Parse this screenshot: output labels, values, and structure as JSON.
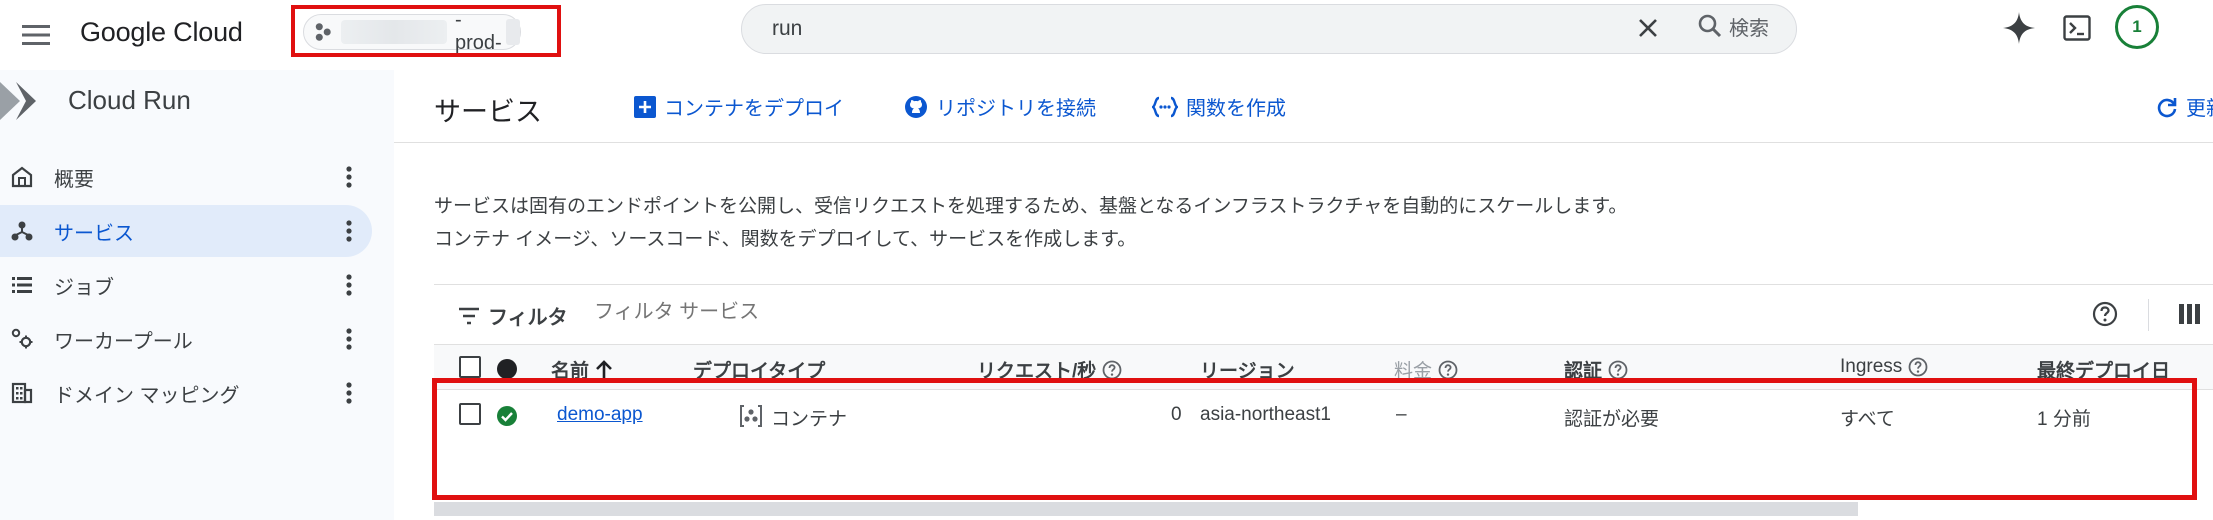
{
  "header": {
    "brand": "Google Cloud",
    "project_name": "-prod-",
    "search_value": "run",
    "search_button": "検索",
    "notification_count": "1"
  },
  "sidebar": {
    "product_title": "Cloud Run",
    "items": [
      {
        "label": "概要",
        "icon": "home-icon"
      },
      {
        "label": "サービス",
        "icon": "services-icon",
        "active": true
      },
      {
        "label": "ジョブ",
        "icon": "list-icon"
      },
      {
        "label": "ワーカープール",
        "icon": "workerpool-icon"
      },
      {
        "label": "ドメイン マッピング",
        "icon": "building-icon"
      }
    ]
  },
  "main": {
    "title": "サービス",
    "actions": {
      "deploy_container": "コンテナをデプロイ",
      "connect_repo": "リポジトリを接続",
      "create_function": "関数を作成",
      "refresh": "更新"
    },
    "description_line1": "サービスは固有のエンドポイントを公開し、受信リクエストを処理するため、基盤となるインフラストラクチャを自動的にスケールします。",
    "description_line2": "コンテナ イメージ、ソースコード、関数をデプロイして、サービスを作成します。",
    "filter": {
      "label": "フィルタ",
      "placeholder": "フィルタ サービス"
    },
    "table": {
      "columns": {
        "name": "名前",
        "deploy_type": "デプロイタイプ",
        "requests": "リクエスト/秒",
        "region": "リージョン",
        "price": "料金",
        "auth": "認証",
        "ingress": "Ingress",
        "last_deployed": "最終デプロイ日"
      },
      "rows": [
        {
          "name": "demo-app",
          "deploy_type": "コンテナ",
          "requests": "0",
          "region": "asia-northeast1",
          "price": "–",
          "auth": "認証が必要",
          "ingress": "すべて",
          "last_deployed": "1 分前"
        }
      ]
    }
  },
  "colors": {
    "accent": "#0b57d0",
    "highlight_box": "#e01010",
    "status_ok": "#188038"
  }
}
